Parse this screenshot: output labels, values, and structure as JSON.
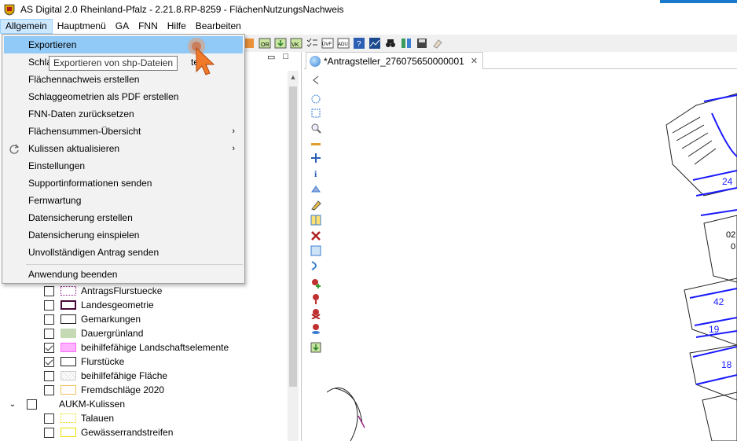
{
  "window": {
    "title": "AS Digital 2.0 Rheinland-Pfalz - 2.21.8.RP-8259 - FlächenNutzungsNachweis"
  },
  "menubar": {
    "items": [
      "Allgemein",
      "Hauptmenü",
      "GA",
      "FNN",
      "Hilfe",
      "Bearbeiten"
    ]
  },
  "dropdown": {
    "items": [
      {
        "label": "Exportieren"
      },
      {
        "label": "Schla"
      },
      {
        "label": "Flächennachweis erstellen"
      },
      {
        "label": "Schlaggeometrien als PDF erstellen"
      },
      {
        "label": "FNN-Daten zurücksetzen"
      },
      {
        "label": "Flächensummen-Übersicht",
        "submenu": "›"
      },
      {
        "label": "Kulissen aktualisieren",
        "submenu": "›",
        "icon": "refresh-icon"
      },
      {
        "label": "Einstellungen"
      },
      {
        "label": "Supportinformationen senden"
      },
      {
        "label": "Fernwartung"
      },
      {
        "label": "Datensicherung erstellen"
      },
      {
        "label": "Datensicherung einspielen"
      },
      {
        "label": "Unvollständigen Antrag senden"
      },
      {
        "label": "Anwendung beenden"
      }
    ],
    "hidden_suffix": "telle"
  },
  "tooltip": {
    "text": "Exportieren von shp-Dateien"
  },
  "tab": {
    "label": "*Antragsteller_276075650000001"
  },
  "layers": [
    {
      "label": "AntragsFlurstuecke",
      "checked": false,
      "swatch": "dotted-purple"
    },
    {
      "label": "Landesgeometrie",
      "checked": false,
      "swatch": "dark-purple-outline"
    },
    {
      "label": "Gemarkungen",
      "checked": false,
      "swatch": "black-outline"
    },
    {
      "label": "Dauergrünland",
      "checked": false,
      "swatch": "green-fill"
    },
    {
      "label": "beihilfefähige Landschaftselemente",
      "checked": true,
      "swatch": "pink-fill"
    },
    {
      "label": "Flurstücke",
      "checked": true,
      "swatch": "black-outline"
    },
    {
      "label": "beihilfefähige Fläche",
      "checked": false,
      "swatch": "grey-hatch"
    },
    {
      "label": "Fremdschläge 2020",
      "checked": false,
      "swatch": "orange-outline"
    }
  ],
  "group": {
    "label": "AUKM-Kulissen",
    "expander": "⌄"
  },
  "sublayers": [
    {
      "label": "Talauen",
      "checked": false,
      "swatch": "yellow-dotted"
    },
    {
      "label": "Gewässerrandstreifen",
      "checked": false,
      "swatch": "yellow-outline"
    }
  ],
  "map": {
    "labels": [
      "24",
      "02",
      "0",
      "42",
      "19",
      "18"
    ]
  },
  "toolbar": {
    "icons": [
      "OR",
      "VK",
      "ÜVF",
      "ADU",
      "?"
    ]
  },
  "colors": {
    "accent": "#1979ca",
    "hover": "#91c9f7",
    "parcel_blue": "#1a1aff",
    "pink": "#ff99ff",
    "green": "#c4d9b4"
  }
}
